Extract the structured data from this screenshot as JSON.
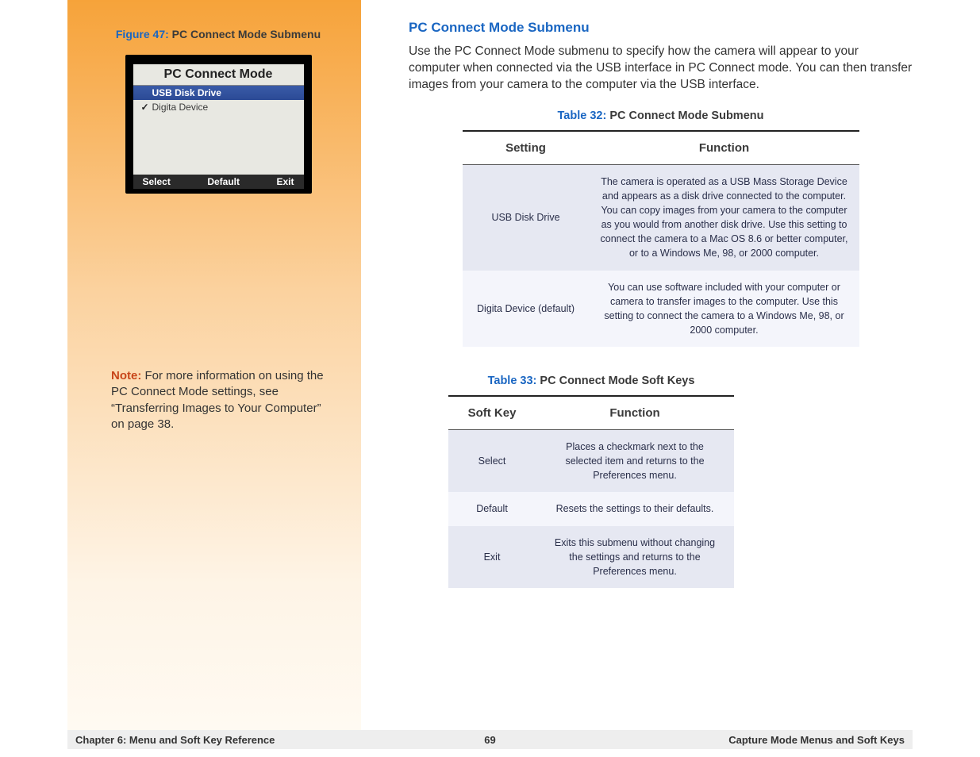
{
  "sidebar": {
    "figure_label": "Figure 47:",
    "figure_title": "PC Connect Mode Submenu",
    "camera": {
      "title": "PC Connect Mode",
      "row1": "USB Disk Drive",
      "row2": "Digita Device",
      "softkeys": {
        "left": "Select",
        "center": "Default",
        "right": "Exit"
      }
    },
    "note_label": "Note:",
    "note_text": "For more information on using the PC Connect Mode settings, see “Transferring Images to Your Computer” on page 38."
  },
  "content": {
    "section_title": "PC Connect Mode Submenu",
    "intro": "Use the PC Connect Mode submenu to specify how the camera will appear to your computer when connected via the USB interface in PC Connect mode. You can then transfer images from your camera to the computer via the USB interface.",
    "table32": {
      "label": "Table 32:",
      "title": "PC Connect Mode Submenu",
      "headers": {
        "col1": "Setting",
        "col2": "Function"
      },
      "rows": [
        {
          "setting": "USB Disk Drive",
          "function": "The camera is operated as a USB Mass Storage Device and appears as a disk drive connected to the computer. You can copy images from your camera to the computer as you would from another disk drive. Use this setting to connect the camera to a Mac OS 8.6 or better computer, or to a Windows Me, 98, or 2000 computer."
        },
        {
          "setting": "Digita Device (default)",
          "function": "You can use software included with your computer or camera to transfer images to the computer. Use this setting to connect the camera to a Windows Me, 98, or 2000 computer."
        }
      ]
    },
    "table33": {
      "label": "Table 33:",
      "title": "PC Connect Mode Soft Keys",
      "headers": {
        "col1": "Soft Key",
        "col2": "Function"
      },
      "rows": [
        {
          "key": "Select",
          "function": "Places a checkmark next to the selected item and returns to the Preferences menu."
        },
        {
          "key": "Default",
          "function": "Resets the settings to their defaults."
        },
        {
          "key": "Exit",
          "function": "Exits this submenu without changing the settings and returns to the Preferences menu."
        }
      ]
    }
  },
  "footer": {
    "left": "Chapter 6: Menu and Soft Key Reference",
    "center": "69",
    "right": "Capture Mode Menus and Soft Keys"
  }
}
